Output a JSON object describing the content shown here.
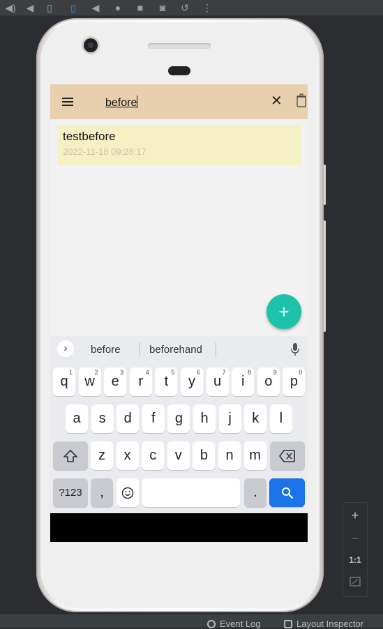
{
  "toolbar_icons": [
    "volume-up-icon",
    "volume-down-icon",
    "rotate-left-icon",
    "rotate-right-icon",
    "back-icon",
    "home-icon",
    "overview-icon",
    "camera-icon",
    "snapshot-icon",
    "more-icon"
  ],
  "app": {
    "search_query": "before",
    "note": {
      "title": "testbefore",
      "date": "2022-11-18 09:28:17"
    },
    "fab_label": "+",
    "colors": {
      "appbar": "#e8d0ae",
      "note_card": "#f6f1c5",
      "fab": "#1cc3a8"
    }
  },
  "keyboard": {
    "suggestions": [
      "before",
      "beforehand"
    ],
    "row1": [
      {
        "k": "q",
        "n": "1"
      },
      {
        "k": "w",
        "n": "2"
      },
      {
        "k": "e",
        "n": "3"
      },
      {
        "k": "r",
        "n": "4"
      },
      {
        "k": "t",
        "n": "5"
      },
      {
        "k": "y",
        "n": "6"
      },
      {
        "k": "u",
        "n": "7"
      },
      {
        "k": "i",
        "n": "8"
      },
      {
        "k": "o",
        "n": "9"
      },
      {
        "k": "p",
        "n": "0"
      }
    ],
    "row2": [
      "a",
      "s",
      "d",
      "f",
      "g",
      "h",
      "j",
      "k",
      "l"
    ],
    "row3": [
      "z",
      "x",
      "c",
      "v",
      "b",
      "n",
      "m"
    ],
    "symbols_key": "?123",
    "comma_key": ",",
    "period_key": ".",
    "search_color": "#1a73e8"
  },
  "zoom": {
    "plus": "+",
    "minus": "−",
    "one_to_one": "1:1"
  },
  "bottom_bar": {
    "event_log": "Event Log",
    "layout_inspector": "Layout Inspector"
  }
}
